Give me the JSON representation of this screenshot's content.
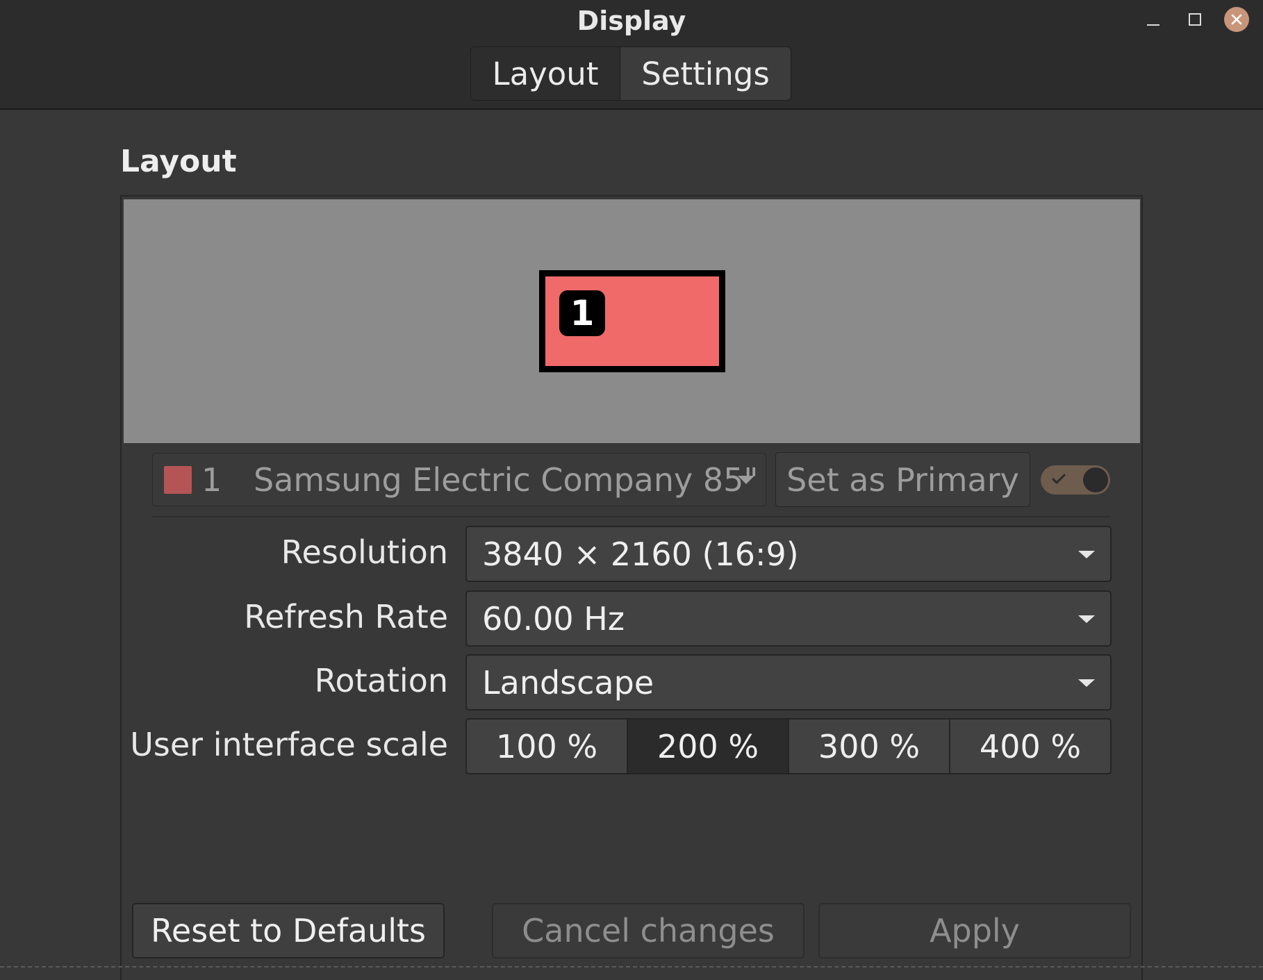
{
  "window": {
    "title": "Display"
  },
  "tabs": [
    {
      "label": "Layout"
    },
    {
      "label": "Settings",
      "selected": true
    }
  ],
  "section": {
    "title": "Layout"
  },
  "preview": {
    "monitor_number": "1",
    "monitor_color": "#f06a6a",
    "background_color": "#8b8b8b"
  },
  "display_selector": {
    "number": "1",
    "name": "Samsung Electric Company 85\"",
    "swatch_color": "#b45454",
    "set_primary_label": "Set as Primary",
    "enabled": true
  },
  "settings": {
    "resolution": {
      "label": "Resolution",
      "value": "3840 × 2160 (16:9)"
    },
    "refresh_rate": {
      "label": "Refresh Rate",
      "value": "60.00 Hz"
    },
    "rotation": {
      "label": "Rotation",
      "value": "Landscape"
    },
    "scale": {
      "label": "User interface scale",
      "options": [
        "100 %",
        "200 %",
        "300 %",
        "400 %"
      ],
      "selected": "200 %"
    }
  },
  "buttons": {
    "reset": "Reset to Defaults",
    "cancel": "Cancel changes",
    "apply": "Apply"
  },
  "colors": {
    "accent": "#c9957a",
    "toggle_on": "#6e5c4d"
  }
}
